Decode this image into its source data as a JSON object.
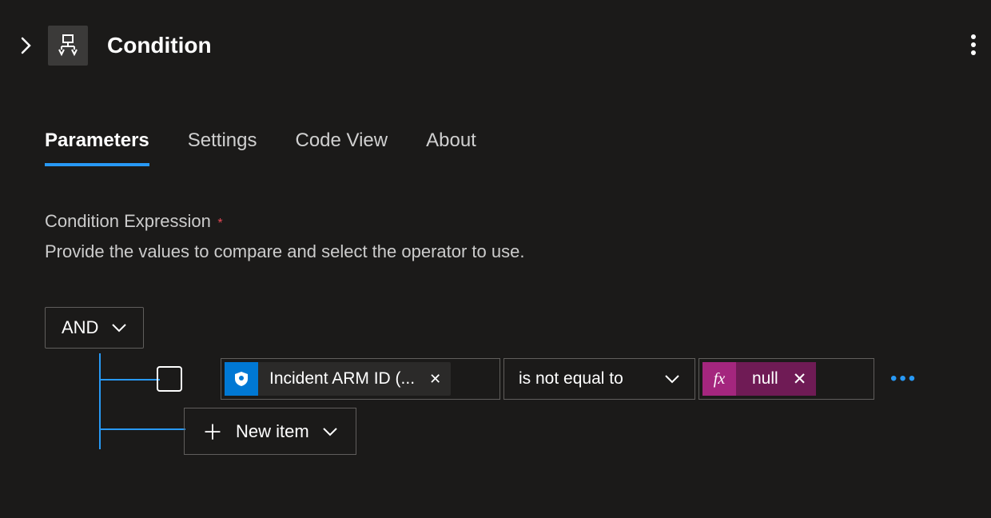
{
  "header": {
    "title": "Condition"
  },
  "tabs": {
    "parameters": "Parameters",
    "settings": "Settings",
    "codeview": "Code View",
    "about": "About"
  },
  "section": {
    "label": "Condition Expression",
    "required_mark": "*",
    "helper": "Provide the values to compare and select the operator to use."
  },
  "expr": {
    "group_op": "AND",
    "row": {
      "value_token": "Incident ARM ID (...",
      "operator": "is not equal to",
      "fx_label": "fx",
      "fx_value": "null"
    },
    "new_item": "New item"
  }
}
